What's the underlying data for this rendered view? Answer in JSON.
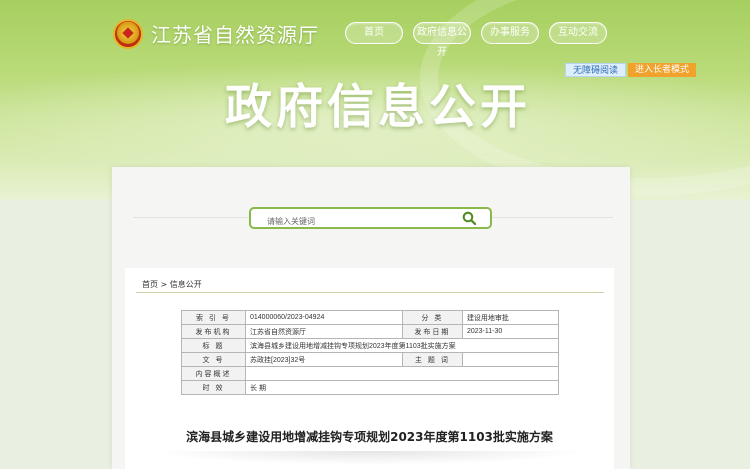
{
  "header": {
    "site_title": "江苏省自然资源厅",
    "nav": [
      "首页",
      "政府信息公开",
      "办事服务",
      "互动交流"
    ],
    "accessibility": {
      "barrier_free": "无障碍阅读",
      "elder_mode": "进入长者模式"
    },
    "hero_title": "政府信息公开"
  },
  "search": {
    "placeholder": "请输入关键词"
  },
  "breadcrumb": {
    "home": "首页",
    "separator": ">",
    "current": "信息公开"
  },
  "meta": {
    "index_label": "索 引 号",
    "index_value": "014000060/2023-04924",
    "category_label": "分 类",
    "category_value": "建设用地审批",
    "publisher_label": "发布机构",
    "publisher_value": "江苏省自然资源厅",
    "date_label": "发布日期",
    "date_value": "2023-11-30",
    "title_label": "标 题",
    "title_value": "滨海县城乡建设用地增减挂钩专项规划2023年度第1103批实施方案",
    "docno_label": "文 号",
    "docno_value": "苏政挂[2023]32号",
    "subject_label": "主 题 词",
    "subject_value": "",
    "summary_label": "内容概述",
    "summary_value": "",
    "validity_label": "时 效",
    "validity_value": "长 期"
  },
  "document": {
    "title": "滨海县城乡建设用地增减挂钩专项规划2023年度第1103批实施方案"
  },
  "colors": {
    "brand_green": "#8ab84a",
    "elder_orange": "#f0a22d"
  }
}
